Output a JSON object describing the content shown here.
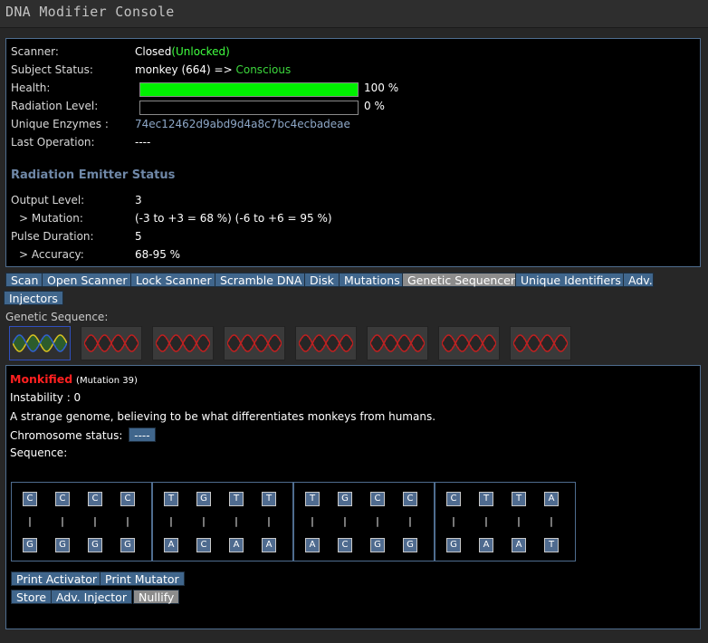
{
  "window": {
    "title": "DNA Modifier Console"
  },
  "status": {
    "scanner_label": "Scanner:",
    "scanner_value": "Closed",
    "scanner_lock": "(Unlocked)",
    "subject_label": "Subject Status:",
    "subject_value": "monkey (664) =>",
    "subject_state": "Conscious",
    "health_label": "Health:",
    "health_fraction": 1.0,
    "health_text": "100 %",
    "radiation_label": "Radiation Level:",
    "radiation_fraction": 0.0,
    "radiation_text": "0 %",
    "enzymes_label": "Unique Enzymes :",
    "enzymes_value": "74ec12462d9abd9d4a8c7bc4ecbadeae",
    "lastop_label": "Last Operation:",
    "lastop_value": "----"
  },
  "emitter": {
    "title": "Radiation Emitter Status",
    "output_label": "Output Level:",
    "output_value": "3",
    "mutation_label": "> Mutation:",
    "mutation_value": "(-3 to +3 = 68 %) (-6 to +6 = 95 %)",
    "pulse_label": "Pulse Duration:",
    "pulse_value": "5",
    "accuracy_label": "> Accuracy:",
    "accuracy_value": "68-95 %"
  },
  "tabs": [
    "Scan",
    "Open Scanner",
    "Lock Scanner",
    "Scramble DNA",
    "Disk",
    "Mutations",
    "Genetic Sequencer",
    "Unique Identifiers",
    "Adv.",
    "Injectors"
  ],
  "active_tab": "Genetic Sequencer",
  "sequence": {
    "label": "Genetic Sequence:",
    "helix_count": 8,
    "selected_index": 0
  },
  "mutation": {
    "name": "Monkified",
    "tag": "(Mutation 39)",
    "instability": "Instability : 0",
    "description": "A strange genome, believing to be what differentiates monkeys from humans.",
    "chromosome_label": "Chromosome status:",
    "chromosome_value": "----",
    "sequence_label": "Sequence:",
    "groups": [
      {
        "top": [
          "C",
          "C",
          "C",
          "C"
        ],
        "bottom": [
          "G",
          "G",
          "G",
          "G"
        ]
      },
      {
        "top": [
          "T",
          "G",
          "T",
          "T"
        ],
        "bottom": [
          "A",
          "C",
          "A",
          "A"
        ]
      },
      {
        "top": [
          "T",
          "G",
          "C",
          "C"
        ],
        "bottom": [
          "A",
          "C",
          "G",
          "G"
        ]
      },
      {
        "top": [
          "C",
          "T",
          "T",
          "A"
        ],
        "bottom": [
          "G",
          "A",
          "A",
          "T"
        ]
      }
    ],
    "bond": "|"
  },
  "actions": {
    "print_activator": "Print Activator",
    "print_mutator": "Print Mutator",
    "store": "Store",
    "adv_injector": "Adv. Injector",
    "nullify": "Nullify"
  },
  "colors": {
    "accent": "#40668c",
    "health": "#00f000",
    "mutation_name": "#ff2020",
    "conscious": "#3cd83c"
  }
}
